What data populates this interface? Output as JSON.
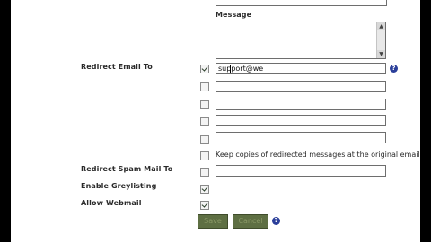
{
  "form": {
    "message_label": "Message",
    "redirect_label": "Redirect Email To",
    "redirect_value": "support@we",
    "keep_copies_text": "Keep copies of redirected messages at the original email ad",
    "redirect_spam_label": "Redirect Spam Mail To",
    "greylisting_label": "Enable Greylisting",
    "webmail_label": "Allow Webmail",
    "help_glyph": "?",
    "save_label": "Save",
    "cancel_label": "Cancel"
  },
  "colors": {
    "button_bg": "#5e6f43",
    "help_icon": "#2b3f9a"
  },
  "state": {
    "redirect_checked": true,
    "greylisting_checked": true,
    "webmail_checked": true
  }
}
